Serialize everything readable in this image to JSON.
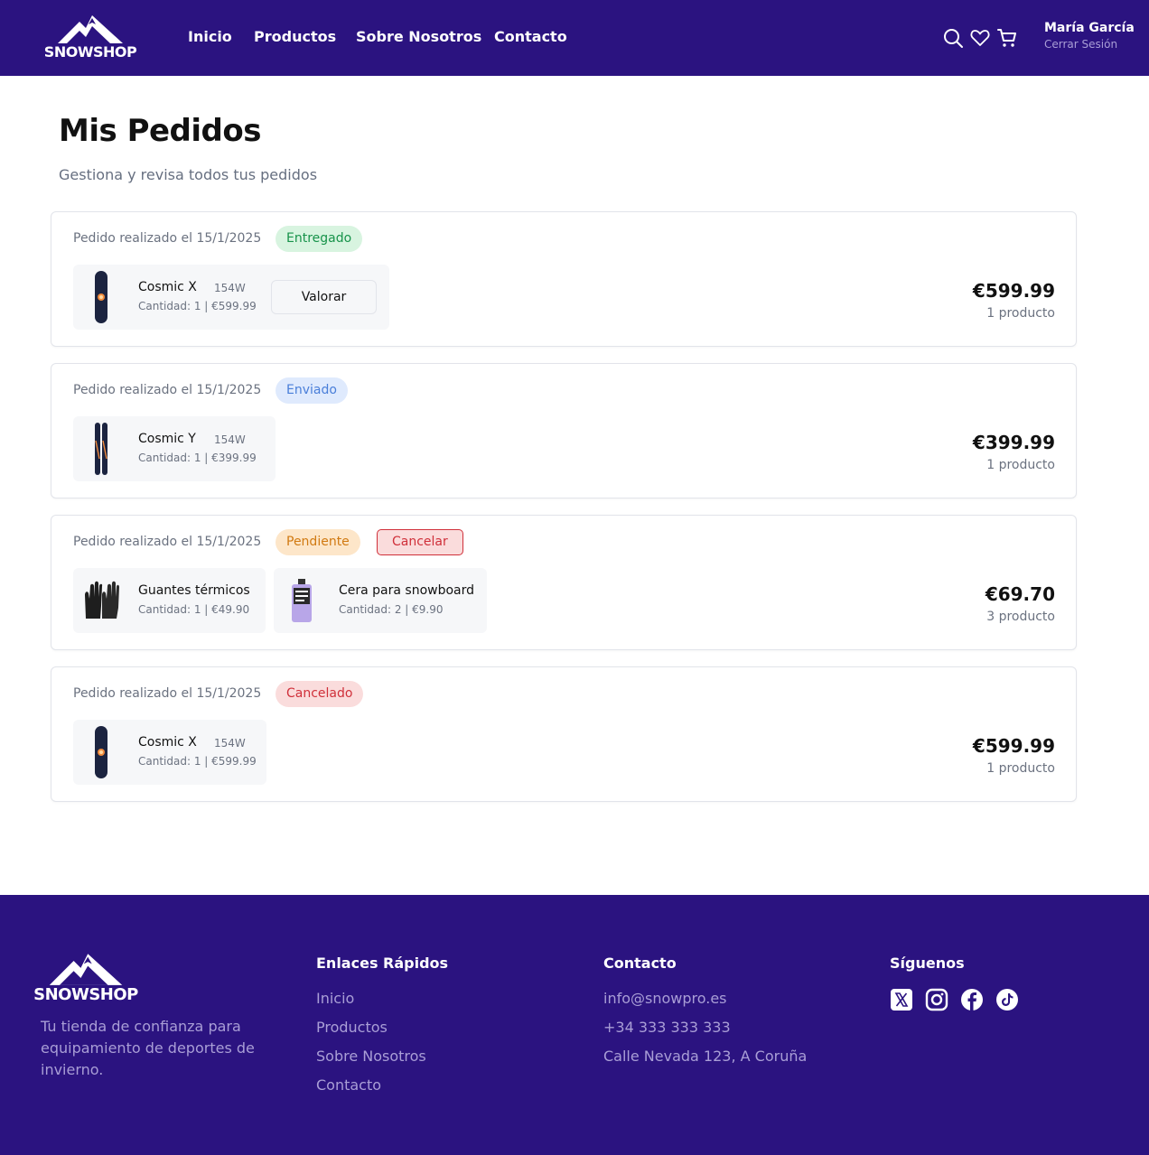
{
  "brand": {
    "name": "SNOWSHOP",
    "primary_color": "#2b1380",
    "accent_muted": "#a99ed6"
  },
  "nav": {
    "items": [
      "Inicio",
      "Productos",
      "Sobre Nosotros",
      "Contacto"
    ]
  },
  "header_icons": [
    "search-icon",
    "heart-icon",
    "cart-icon"
  ],
  "user": {
    "name": "María García",
    "logout_label": "Cerrar Sesión"
  },
  "page": {
    "title": "Mis Pedidos",
    "subtitle": "Gestiona y revisa todos tus pedidos"
  },
  "orders": [
    {
      "date_label": "Pedido realizado el 15/1/2025",
      "status": "Entregado",
      "status_color": "#17934a",
      "action_label": "Valorar",
      "items": [
        {
          "name": "Cosmic X",
          "size": "154W",
          "qty_label": "Cantidad: 1 | €599.99",
          "image": "snowboard-dark-icon"
        }
      ],
      "total": "€599.99",
      "count_label": "1 producto"
    },
    {
      "date_label": "Pedido realizado el 15/1/2025",
      "status": "Enviado",
      "status_color": "#4a7fd9",
      "items": [
        {
          "name": "Cosmic Y",
          "size": "154W",
          "qty_label": "Cantidad: 1 | €399.99",
          "image": "skis-icon"
        }
      ],
      "total": "€399.99",
      "count_label": "1 producto"
    },
    {
      "date_label": "Pedido realizado el 15/1/2025",
      "status": "Pendiente",
      "status_color": "#d17a12",
      "cancel_label": "Cancelar",
      "items": [
        {
          "name": "Guantes térmicos",
          "qty_label": "Cantidad: 1 | €49.90",
          "image": "gloves-icon"
        },
        {
          "name": "Cera para snowboard",
          "qty_label": "Cantidad: 2 | €9.90",
          "image": "wax-bottle-icon"
        }
      ],
      "total": "€69.70",
      "count_label": "3 producto"
    },
    {
      "date_label": "Pedido realizado el 15/1/2025",
      "status": "Cancelado",
      "status_color": "#d0303a",
      "items": [
        {
          "name": "Cosmic X",
          "size": "154W",
          "qty_label": "Cantidad: 1 | €599.99",
          "image": "snowboard-dark-icon"
        }
      ],
      "total": "€599.99",
      "count_label": "1 producto"
    }
  ],
  "footer": {
    "tagline": "Tu tienda de confianza para equipamiento de deportes de invierno.",
    "quick_links": {
      "title": "Enlaces Rápidos",
      "items": [
        "Inicio",
        "Productos",
        "Sobre Nosotros",
        "Contacto"
      ]
    },
    "contact": {
      "title": "Contacto",
      "items": [
        "info@snowpro.es",
        "+34 333 333 333",
        "Calle Nevada 123, A Coruña"
      ]
    },
    "social": {
      "title": "Síguenos",
      "icons": [
        "x-icon",
        "instagram-icon",
        "facebook-icon",
        "tiktok-icon"
      ]
    }
  }
}
